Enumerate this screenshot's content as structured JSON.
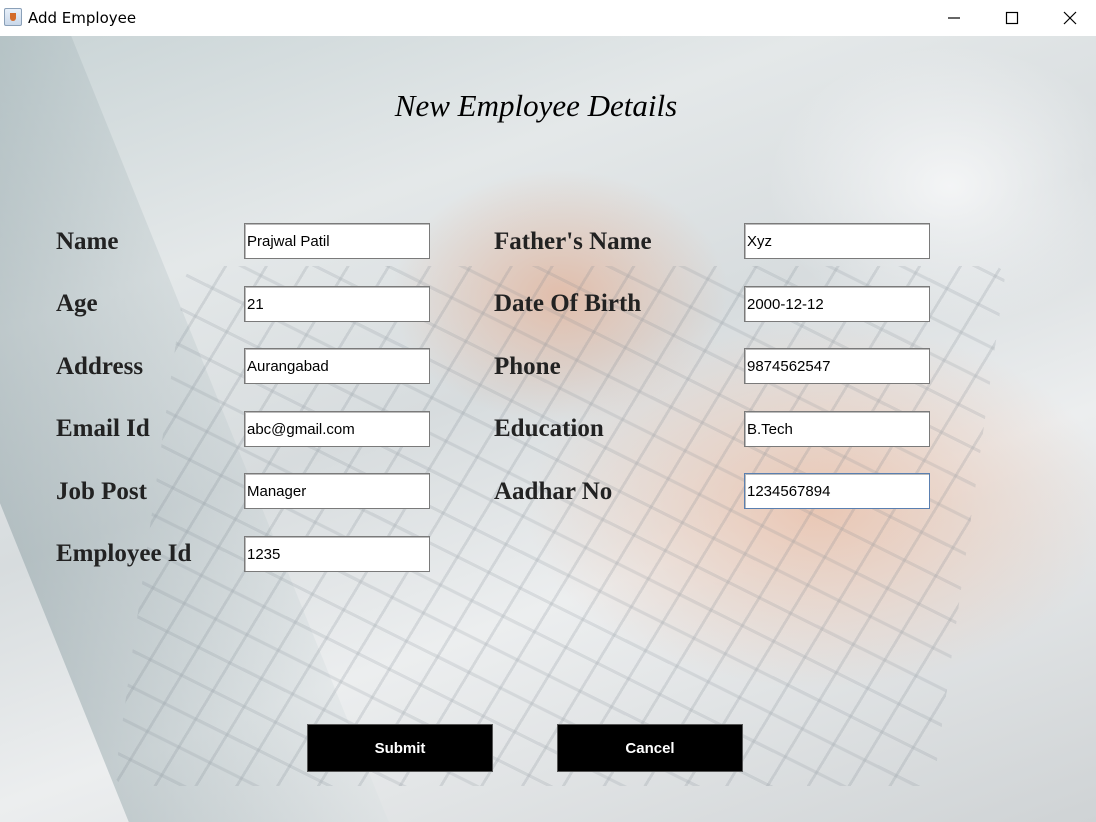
{
  "window": {
    "title": "Add Employee",
    "icon": "java-cup-icon",
    "controls": [
      "minimize-icon",
      "maximize-icon",
      "close-icon"
    ]
  },
  "form": {
    "heading": "New Employee Details",
    "left": [
      {
        "label": "Name",
        "value": "Prajwal Patil"
      },
      {
        "label": "Age",
        "value": "21"
      },
      {
        "label": "Address",
        "value": "Aurangabad"
      },
      {
        "label": "Email Id",
        "value": "abc@gmail.com"
      },
      {
        "label": "Job Post",
        "value": "Manager"
      },
      {
        "label": "Employee Id",
        "value": "1235"
      }
    ],
    "right": [
      {
        "label": "Father's Name",
        "value": "Xyz"
      },
      {
        "label": "Date Of Birth",
        "value": "2000-12-12"
      },
      {
        "label": "Phone",
        "value": "9874562547"
      },
      {
        "label": "Education",
        "value": "B.Tech"
      },
      {
        "label": "Aadhar No",
        "value": "1234567894"
      }
    ]
  },
  "buttons": {
    "submit": "Submit",
    "cancel": "Cancel"
  }
}
